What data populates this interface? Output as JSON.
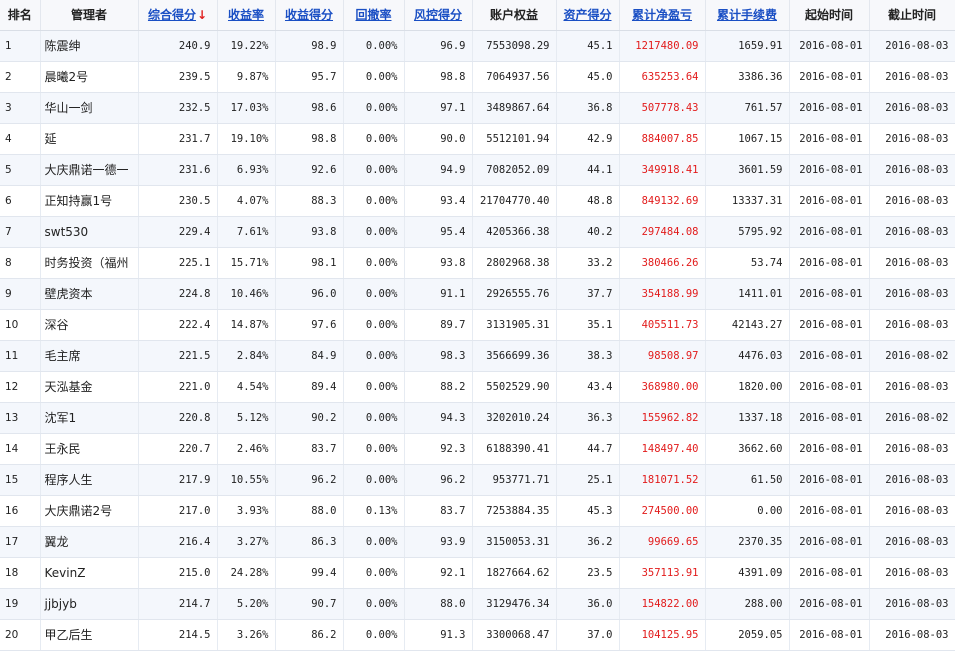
{
  "headers": [
    {
      "key": "rank",
      "label": "排名",
      "link": false,
      "sorted": false
    },
    {
      "key": "manager",
      "label": "管理者",
      "link": false,
      "sorted": false
    },
    {
      "key": "composite",
      "label": "综合得分",
      "link": true,
      "sorted": true,
      "arrow": "↓"
    },
    {
      "key": "return_rate",
      "label": "收益率",
      "link": true,
      "sorted": false
    },
    {
      "key": "return_score",
      "label": "收益得分",
      "link": true,
      "sorted": false
    },
    {
      "key": "drawdown",
      "label": "回撤率",
      "link": true,
      "sorted": false
    },
    {
      "key": "risk_score",
      "label": "风控得分",
      "link": true,
      "sorted": false
    },
    {
      "key": "equity",
      "label": "账户权益",
      "link": false,
      "sorted": false
    },
    {
      "key": "asset_score",
      "label": "资产得分",
      "link": true,
      "sorted": false
    },
    {
      "key": "net_pnl",
      "label": "累计净盈亏",
      "link": true,
      "sorted": false
    },
    {
      "key": "fees",
      "label": "累计手续费",
      "link": true,
      "sorted": false
    },
    {
      "key": "start",
      "label": "起始时间",
      "link": false,
      "sorted": false
    },
    {
      "key": "end",
      "label": "截止时间",
      "link": false,
      "sorted": false
    }
  ],
  "rows": [
    {
      "rank": "1",
      "manager": "陈震绅",
      "composite": "240.9",
      "return_rate": "19.22%",
      "return_score": "98.9",
      "drawdown": "0.00%",
      "risk_score": "96.9",
      "equity": "7553098.29",
      "asset_score": "45.1",
      "net_pnl": "1217480.09",
      "fees": "1659.91",
      "start": "2016-08-01",
      "end": "2016-08-03"
    },
    {
      "rank": "2",
      "manager": "晨曦2号",
      "composite": "239.5",
      "return_rate": "9.87%",
      "return_score": "95.7",
      "drawdown": "0.00%",
      "risk_score": "98.8",
      "equity": "7064937.56",
      "asset_score": "45.0",
      "net_pnl": "635253.64",
      "fees": "3386.36",
      "start": "2016-08-01",
      "end": "2016-08-03"
    },
    {
      "rank": "3",
      "manager": "华山一剑",
      "composite": "232.5",
      "return_rate": "17.03%",
      "return_score": "98.6",
      "drawdown": "0.00%",
      "risk_score": "97.1",
      "equity": "3489867.64",
      "asset_score": "36.8",
      "net_pnl": "507778.43",
      "fees": "761.57",
      "start": "2016-08-01",
      "end": "2016-08-03"
    },
    {
      "rank": "4",
      "manager": "延",
      "composite": "231.7",
      "return_rate": "19.10%",
      "return_score": "98.8",
      "drawdown": "0.00%",
      "risk_score": "90.0",
      "equity": "5512101.94",
      "asset_score": "42.9",
      "net_pnl": "884007.85",
      "fees": "1067.15",
      "start": "2016-08-01",
      "end": "2016-08-03"
    },
    {
      "rank": "5",
      "manager": "大庆鼎诺一德一",
      "composite": "231.6",
      "return_rate": "6.93%",
      "return_score": "92.6",
      "drawdown": "0.00%",
      "risk_score": "94.9",
      "equity": "7082052.09",
      "asset_score": "44.1",
      "net_pnl": "349918.41",
      "fees": "3601.59",
      "start": "2016-08-01",
      "end": "2016-08-03"
    },
    {
      "rank": "6",
      "manager": "正知持赢1号",
      "composite": "230.5",
      "return_rate": "4.07%",
      "return_score": "88.3",
      "drawdown": "0.00%",
      "risk_score": "93.4",
      "equity": "21704770.40",
      "asset_score": "48.8",
      "net_pnl": "849132.69",
      "fees": "13337.31",
      "start": "2016-08-01",
      "end": "2016-08-03"
    },
    {
      "rank": "7",
      "manager": "swt530",
      "composite": "229.4",
      "return_rate": "7.61%",
      "return_score": "93.8",
      "drawdown": "0.00%",
      "risk_score": "95.4",
      "equity": "4205366.38",
      "asset_score": "40.2",
      "net_pnl": "297484.08",
      "fees": "5795.92",
      "start": "2016-08-01",
      "end": "2016-08-03"
    },
    {
      "rank": "8",
      "manager": "时务投资（福州",
      "composite": "225.1",
      "return_rate": "15.71%",
      "return_score": "98.1",
      "drawdown": "0.00%",
      "risk_score": "93.8",
      "equity": "2802968.38",
      "asset_score": "33.2",
      "net_pnl": "380466.26",
      "fees": "53.74",
      "start": "2016-08-01",
      "end": "2016-08-03"
    },
    {
      "rank": "9",
      "manager": "壁虎资本",
      "composite": "224.8",
      "return_rate": "10.46%",
      "return_score": "96.0",
      "drawdown": "0.00%",
      "risk_score": "91.1",
      "equity": "2926555.76",
      "asset_score": "37.7",
      "net_pnl": "354188.99",
      "fees": "1411.01",
      "start": "2016-08-01",
      "end": "2016-08-03"
    },
    {
      "rank": "10",
      "manager": "深谷",
      "composite": "222.4",
      "return_rate": "14.87%",
      "return_score": "97.6",
      "drawdown": "0.00%",
      "risk_score": "89.7",
      "equity": "3131905.31",
      "asset_score": "35.1",
      "net_pnl": "405511.73",
      "fees": "42143.27",
      "start": "2016-08-01",
      "end": "2016-08-03"
    },
    {
      "rank": "11",
      "manager": "毛主席",
      "composite": "221.5",
      "return_rate": "2.84%",
      "return_score": "84.9",
      "drawdown": "0.00%",
      "risk_score": "98.3",
      "equity": "3566699.36",
      "asset_score": "38.3",
      "net_pnl": "98508.97",
      "fees": "4476.03",
      "start": "2016-08-01",
      "end": "2016-08-02"
    },
    {
      "rank": "12",
      "manager": "天泓基金",
      "composite": "221.0",
      "return_rate": "4.54%",
      "return_score": "89.4",
      "drawdown": "0.00%",
      "risk_score": "88.2",
      "equity": "5502529.90",
      "asset_score": "43.4",
      "net_pnl": "368980.00",
      "fees": "1820.00",
      "start": "2016-08-01",
      "end": "2016-08-03"
    },
    {
      "rank": "13",
      "manager": "沈军1",
      "composite": "220.8",
      "return_rate": "5.12%",
      "return_score": "90.2",
      "drawdown": "0.00%",
      "risk_score": "94.3",
      "equity": "3202010.24",
      "asset_score": "36.3",
      "net_pnl": "155962.82",
      "fees": "1337.18",
      "start": "2016-08-01",
      "end": "2016-08-02"
    },
    {
      "rank": "14",
      "manager": "王永民",
      "composite": "220.7",
      "return_rate": "2.46%",
      "return_score": "83.7",
      "drawdown": "0.00%",
      "risk_score": "92.3",
      "equity": "6188390.41",
      "asset_score": "44.7",
      "net_pnl": "148497.40",
      "fees": "3662.60",
      "start": "2016-08-01",
      "end": "2016-08-03"
    },
    {
      "rank": "15",
      "manager": "程序人生",
      "composite": "217.9",
      "return_rate": "10.55%",
      "return_score": "96.2",
      "drawdown": "0.00%",
      "risk_score": "96.2",
      "equity": "953771.71",
      "asset_score": "25.1",
      "net_pnl": "181071.52",
      "fees": "61.50",
      "start": "2016-08-01",
      "end": "2016-08-03"
    },
    {
      "rank": "16",
      "manager": "大庆鼎诺2号",
      "composite": "217.0",
      "return_rate": "3.93%",
      "return_score": "88.0",
      "drawdown": "0.13%",
      "risk_score": "83.7",
      "equity": "7253884.35",
      "asset_score": "45.3",
      "net_pnl": "274500.00",
      "fees": "0.00",
      "start": "2016-08-01",
      "end": "2016-08-03"
    },
    {
      "rank": "17",
      "manager": "翼龙",
      "composite": "216.4",
      "return_rate": "3.27%",
      "return_score": "86.3",
      "drawdown": "0.00%",
      "risk_score": "93.9",
      "equity": "3150053.31",
      "asset_score": "36.2",
      "net_pnl": "99669.65",
      "fees": "2370.35",
      "start": "2016-08-01",
      "end": "2016-08-03"
    },
    {
      "rank": "18",
      "manager": "KevinZ",
      "composite": "215.0",
      "return_rate": "24.28%",
      "return_score": "99.4",
      "drawdown": "0.00%",
      "risk_score": "92.1",
      "equity": "1827664.62",
      "asset_score": "23.5",
      "net_pnl": "357113.91",
      "fees": "4391.09",
      "start": "2016-08-01",
      "end": "2016-08-03"
    },
    {
      "rank": "19",
      "manager": "jjbjyb",
      "composite": "214.7",
      "return_rate": "5.20%",
      "return_score": "90.7",
      "drawdown": "0.00%",
      "risk_score": "88.0",
      "equity": "3129476.34",
      "asset_score": "36.0",
      "net_pnl": "154822.00",
      "fees": "288.00",
      "start": "2016-08-01",
      "end": "2016-08-03"
    },
    {
      "rank": "20",
      "manager": "甲乙后生",
      "composite": "214.5",
      "return_rate": "3.26%",
      "return_score": "86.2",
      "drawdown": "0.00%",
      "risk_score": "91.3",
      "equity": "3300068.47",
      "asset_score": "37.0",
      "net_pnl": "104125.95",
      "fees": "2059.05",
      "start": "2016-08-01",
      "end": "2016-08-03"
    }
  ],
  "colors": {
    "link": "#1a4fc4",
    "pnl": "#e21b1b",
    "sort_arrow": "#e02020"
  }
}
